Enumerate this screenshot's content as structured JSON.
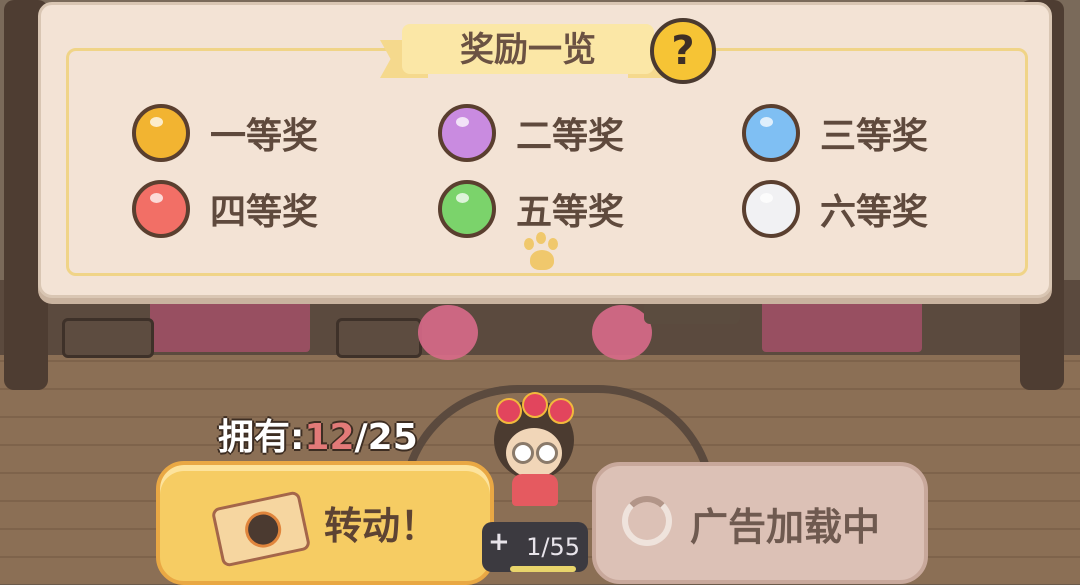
{
  "panel": {
    "title": "奖励一览",
    "help_icon": "question-mark-icon",
    "prizes": [
      {
        "label": "一等奖",
        "color": "#f2b431"
      },
      {
        "label": "二等奖",
        "color": "#c98be0"
      },
      {
        "label": "三等奖",
        "color": "#7fbff3"
      },
      {
        "label": "四等奖",
        "color": "#f26f66"
      },
      {
        "label": "五等奖",
        "color": "#7bd36b"
      },
      {
        "label": "六等奖",
        "color": "#f1f1f3"
      }
    ]
  },
  "inventory": {
    "label": "拥有:",
    "current": "12",
    "separator": "/",
    "total": "25"
  },
  "spin_button": {
    "label": "转动！",
    "icon": "ticket-icon"
  },
  "ad_button": {
    "label": "广告加载中",
    "icon": "loading-spinner-icon"
  },
  "energy": {
    "plus": "+",
    "value": "1/55"
  }
}
